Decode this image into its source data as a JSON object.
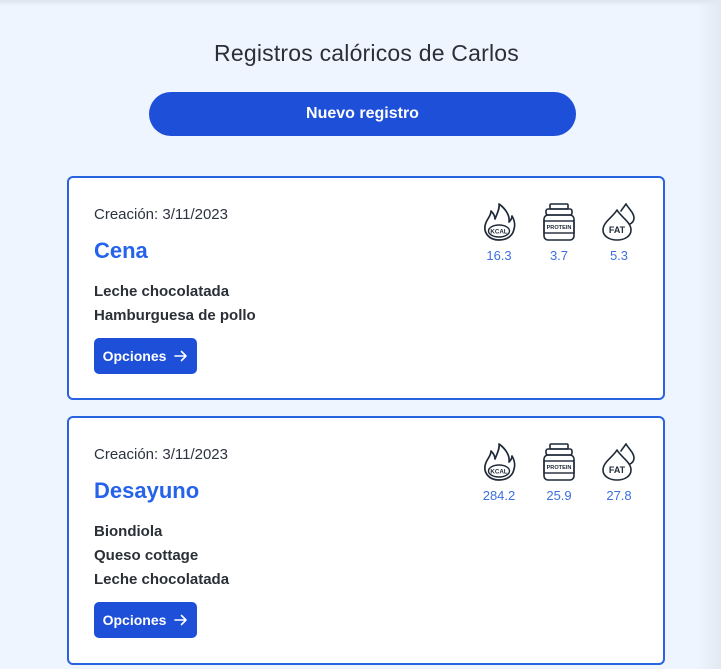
{
  "page": {
    "title": "Registros calóricos de Carlos",
    "new_button": "Nuevo registro"
  },
  "icons": {
    "kcal_label": "KCAL",
    "protein_label": "PROTEIN",
    "fat_label": "FAT"
  },
  "colors": {
    "primary": "#1d4fd8",
    "card_border": "#2a63e0",
    "title_accent": "#2563eb",
    "metric_value": "#3d6fe0",
    "background": "#eff5ff"
  },
  "records": [
    {
      "created": "Creación: 3/11/2023",
      "name": "Cena",
      "items": [
        "Leche chocolatada",
        "Hamburguesa de pollo"
      ],
      "kcal": "16.3",
      "protein": "3.7",
      "fat": "5.3",
      "options_label": "Opciones"
    },
    {
      "created": "Creación: 3/11/2023",
      "name": "Desayuno",
      "items": [
        "Biondiola",
        "Queso cottage",
        "Leche chocolatada"
      ],
      "kcal": "284.2",
      "protein": "25.9",
      "fat": "27.8",
      "options_label": "Opciones"
    }
  ]
}
